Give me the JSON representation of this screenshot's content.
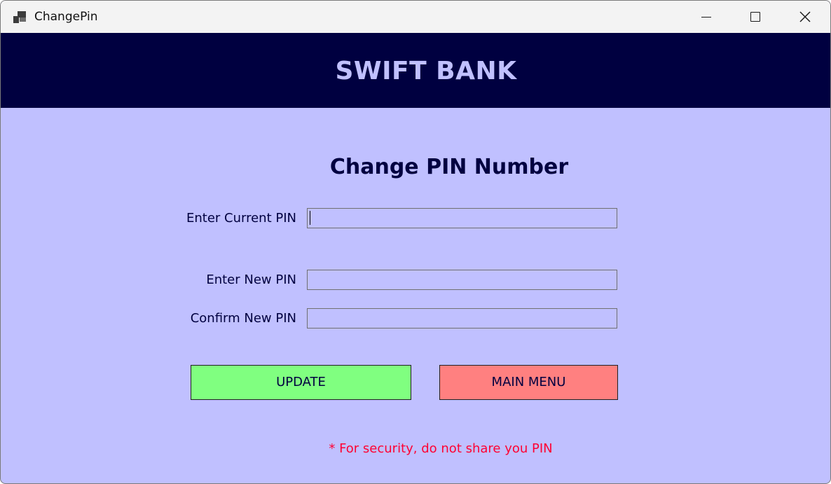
{
  "window": {
    "title": "ChangePin",
    "controls": {
      "minimize": "minimize-icon",
      "maximize": "maximize-icon",
      "close": "close-icon"
    }
  },
  "header": {
    "brand": "SWIFT BANK"
  },
  "form": {
    "title": "Change PIN Number",
    "fields": {
      "current": {
        "label": "Enter Current PIN",
        "value": ""
      },
      "new": {
        "label": "Enter New PIN",
        "value": ""
      },
      "confirm": {
        "label": "Confirm New PIN",
        "value": ""
      }
    },
    "buttons": {
      "update": "UPDATE",
      "main_menu": "MAIN MENU"
    },
    "security_note": "* For security, do not share you PIN"
  },
  "colors": {
    "background": "#c0c0ff",
    "header_band": "#000040",
    "brand_text": "#c0c0ff",
    "update_button": "#80ff80",
    "main_menu_button": "#ff8080",
    "warning_text": "#ff0033"
  }
}
